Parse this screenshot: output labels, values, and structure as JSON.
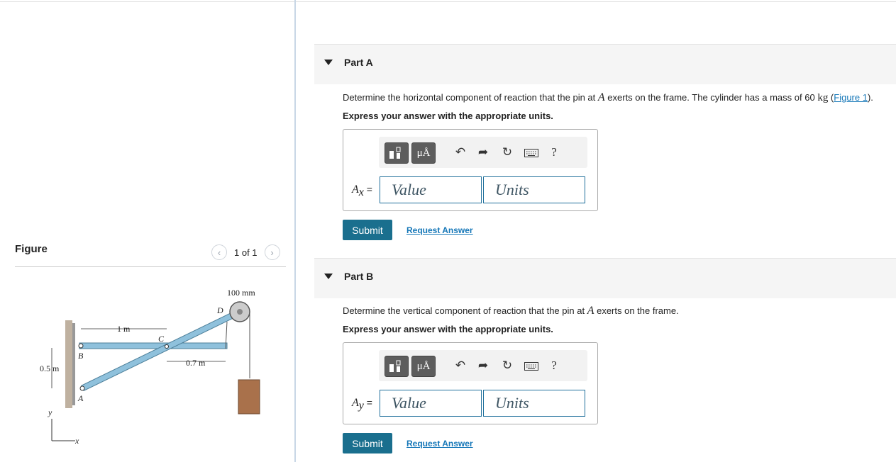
{
  "figure_panel": {
    "title": "Figure",
    "pager": "1 of 1",
    "prev_icon": "chevron-left-icon",
    "next_icon": "chevron-right-icon",
    "labels": {
      "dim_100mm": "100 mm",
      "point_D": "D",
      "point_C": "C",
      "point_B": "B",
      "point_A": "A",
      "dim_1m": "1 m",
      "dim_07m": "0.7 m",
      "dim_05m": "0.5 m",
      "axis_y": "y",
      "axis_x": "x"
    }
  },
  "parts": [
    {
      "label": "Part A",
      "question_pre": "Determine the horizontal component of reaction that the pin at ",
      "question_var": "A",
      "question_mid": " exerts on the frame. The cylinder has a mass of 60 ",
      "question_unit": "kg",
      "question_link": "Figure 1",
      "question_end": ").",
      "instruction": "Express your answer with the appropriate units.",
      "answer_var": "A",
      "answer_sub": "x",
      "answer_eq": " =",
      "value_placeholder": "Value",
      "units_placeholder": "Units",
      "submit": "Submit",
      "request": "Request Answer"
    },
    {
      "label": "Part B",
      "question_pre": "Determine the vertical component of reaction that the pin at ",
      "question_var": "A",
      "question_mid": " exerts on the frame.",
      "instruction": "Express your answer with the appropriate units.",
      "answer_var": "A",
      "answer_sub": "y",
      "answer_eq": " =",
      "value_placeholder": "Value",
      "units_placeholder": "Units",
      "submit": "Submit",
      "request": "Request Answer"
    }
  ],
  "toolbar": {
    "template_icon": "fraction-template-icon",
    "units_button": "μÅ",
    "undo_icon": "undo-icon",
    "redo_icon": "redo-icon",
    "reset_icon": "reset-icon",
    "keyboard_icon": "keyboard-icon",
    "help": "?"
  },
  "colors": {
    "accent": "#1a6f8e",
    "link": "#1577b8",
    "member": "#8fc1dc",
    "cylinder": "#a9714b"
  }
}
